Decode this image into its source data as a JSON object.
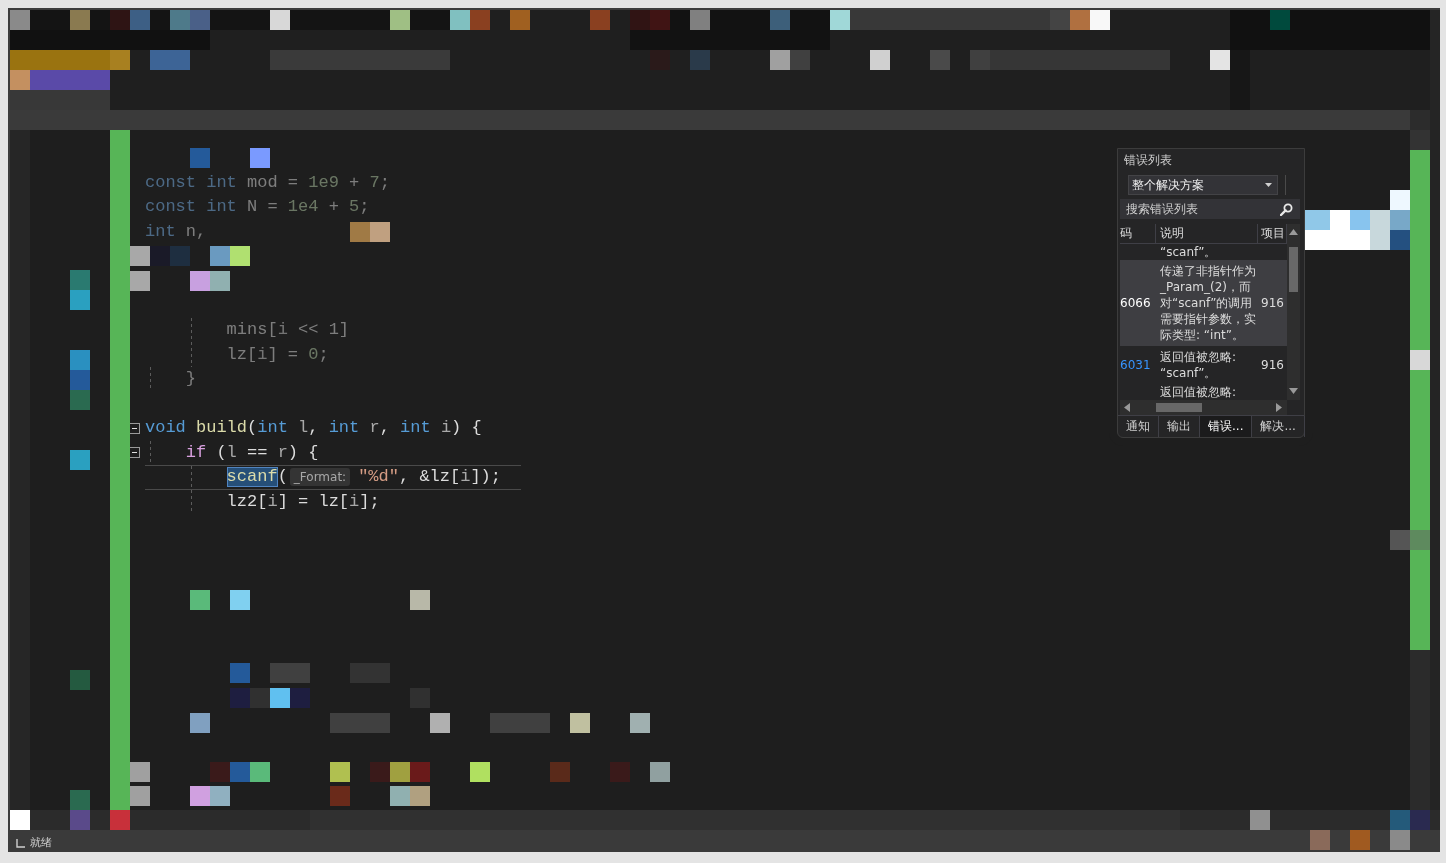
{
  "editor": {
    "lines": [
      {
        "kind": "obscured",
        "current": false
      },
      {
        "kind": "code",
        "faded": true,
        "current": false,
        "tokens": [
          {
            "text": "const ",
            "kind": "keyword",
            "selected": false
          },
          {
            "text": "int",
            "kind": "keyword",
            "selected": false
          },
          {
            "text": " mod = ",
            "kind": "plain",
            "selected": false
          },
          {
            "text": "1e9",
            "kind": "number",
            "selected": false
          },
          {
            "text": " + ",
            "kind": "plain",
            "selected": false
          },
          {
            "text": "7",
            "kind": "number",
            "selected": false
          },
          {
            "text": ";",
            "kind": "plain",
            "selected": false
          }
        ]
      },
      {
        "kind": "code",
        "faded": true,
        "current": false,
        "tokens": [
          {
            "text": "const ",
            "kind": "keyword",
            "selected": false
          },
          {
            "text": "int",
            "kind": "keyword",
            "selected": false
          },
          {
            "text": " N = ",
            "kind": "plain",
            "selected": false
          },
          {
            "text": "1e4",
            "kind": "number",
            "selected": false
          },
          {
            "text": " + ",
            "kind": "plain",
            "selected": false
          },
          {
            "text": "5",
            "kind": "number",
            "selected": false
          },
          {
            "text": ";",
            "kind": "plain",
            "selected": false
          }
        ]
      },
      {
        "kind": "code",
        "faded": true,
        "current": false,
        "tokens": [
          {
            "text": "int",
            "kind": "keyword",
            "selected": false
          },
          {
            "text": " n,",
            "kind": "plain",
            "selected": false
          }
        ]
      },
      {
        "kind": "obscured",
        "current": false
      },
      {
        "kind": "obscured",
        "current": false
      },
      {
        "kind": "obscured",
        "current": false
      },
      {
        "kind": "code",
        "faded": true,
        "current": false,
        "tokens": [
          {
            "text": "        mins[",
            "kind": "plain",
            "selected": false
          },
          {
            "text": "i",
            "kind": "param",
            "selected": false
          },
          {
            "text": " << 1]",
            "kind": "plain",
            "selected": false
          }
        ]
      },
      {
        "kind": "code",
        "faded": true,
        "current": false,
        "tokens": [
          {
            "text": "        lz[",
            "kind": "plain",
            "selected": false
          },
          {
            "text": "i",
            "kind": "param",
            "selected": false
          },
          {
            "text": "] = ",
            "kind": "plain",
            "selected": false
          },
          {
            "text": "0",
            "kind": "number",
            "selected": false
          },
          {
            "text": ";",
            "kind": "plain",
            "selected": false
          }
        ]
      },
      {
        "kind": "code",
        "faded": true,
        "current": false,
        "tokens": [
          {
            "text": "    }",
            "kind": "plain",
            "selected": false
          }
        ]
      },
      {
        "kind": "obscured",
        "current": false
      },
      {
        "kind": "code",
        "faded": false,
        "current": false,
        "expanded": true,
        "tokens": [
          {
            "text": "void ",
            "kind": "keyword",
            "selected": false
          },
          {
            "text": "build",
            "kind": "function",
            "selected": false
          },
          {
            "text": "(",
            "kind": "plain",
            "selected": false
          },
          {
            "text": "int ",
            "kind": "keyword",
            "selected": false
          },
          {
            "text": "l",
            "kind": "param",
            "selected": false
          },
          {
            "text": ", ",
            "kind": "plain",
            "selected": false
          },
          {
            "text": "int ",
            "kind": "keyword",
            "selected": false
          },
          {
            "text": "r",
            "kind": "param",
            "selected": false
          },
          {
            "text": ", ",
            "kind": "plain",
            "selected": false
          },
          {
            "text": "int ",
            "kind": "keyword",
            "selected": false
          },
          {
            "text": "i",
            "kind": "param",
            "selected": false
          },
          {
            "text": ") {",
            "kind": "plain",
            "selected": false
          }
        ]
      },
      {
        "kind": "code",
        "faded": false,
        "current": false,
        "expanded": true,
        "tokens": [
          {
            "text": "    if",
            "kind": "control",
            "selected": false
          },
          {
            "text": " (",
            "kind": "plain",
            "selected": false
          },
          {
            "text": "l",
            "kind": "param",
            "selected": false
          },
          {
            "text": " == ",
            "kind": "plain",
            "selected": false
          },
          {
            "text": "r",
            "kind": "param",
            "selected": false
          },
          {
            "text": ") {",
            "kind": "plain",
            "selected": false
          }
        ]
      },
      {
        "kind": "code",
        "faded": false,
        "current": true,
        "tokens": [
          {
            "text": "        scanf",
            "kind": "function",
            "selected": true
          },
          {
            "text": "(",
            "kind": "plain",
            "selected": false
          },
          {
            "text": "_Format:",
            "kind": "hint",
            "selected": false
          },
          {
            "text": "\"%d\"",
            "kind": "string",
            "selected": false
          },
          {
            "text": ", &lz[",
            "kind": "plain",
            "selected": false
          },
          {
            "text": "i",
            "kind": "param",
            "selected": false
          },
          {
            "text": "]);",
            "kind": "plain",
            "selected": false
          }
        ]
      },
      {
        "kind": "code",
        "faded": false,
        "current": false,
        "tokens": [
          {
            "text": "        lz2[",
            "kind": "plain",
            "selected": false
          },
          {
            "text": "i",
            "kind": "param",
            "selected": false
          },
          {
            "text": "] = lz[",
            "kind": "plain",
            "selected": false
          },
          {
            "text": "i",
            "kind": "param",
            "selected": false
          },
          {
            "text": "];",
            "kind": "plain",
            "selected": false
          }
        ]
      },
      {
        "kind": "obscured",
        "current": false
      },
      {
        "kind": "obscured",
        "current": false
      },
      {
        "kind": "obscured",
        "current": false
      },
      {
        "kind": "obscured",
        "current": false
      },
      {
        "kind": "obscured",
        "current": false
      },
      {
        "kind": "obscured",
        "current": false
      },
      {
        "kind": "obscured",
        "current": false
      },
      {
        "kind": "obscured",
        "current": false
      },
      {
        "kind": "obscured",
        "current": false
      },
      {
        "kind": "obscured",
        "current": false
      },
      {
        "kind": "obscured",
        "current": false
      },
      {
        "kind": "obscured",
        "current": false
      }
    ]
  },
  "error_list": {
    "title": "错误列表",
    "scope": "整个解决方案",
    "search": {
      "placeholder": "搜索错误列表"
    },
    "columns": [
      "码",
      "说明",
      "项目"
    ],
    "rows": [
      {
        "description": "“scanf”。",
        "selected": false
      },
      {
        "code": "6066",
        "description": "传递了非指针作为_Param_(2)，而对“scanf”的调用需要指针参数，实际类型: “int”。",
        "project": "916",
        "selected": true
      },
      {
        "code": "6031",
        "description": "返回值被忽略: “scanf”。",
        "project": "916",
        "selected": false
      },
      {
        "description": "返回值被忽略:",
        "selected": false
      }
    ],
    "tabs": [
      {
        "label": "通知",
        "selected": false
      },
      {
        "label": "输出",
        "selected": false
      },
      {
        "label": "错误...",
        "selected": true
      },
      {
        "label": "解决...",
        "selected": false
      }
    ]
  },
  "status_bar": {
    "text": "就绪"
  }
}
